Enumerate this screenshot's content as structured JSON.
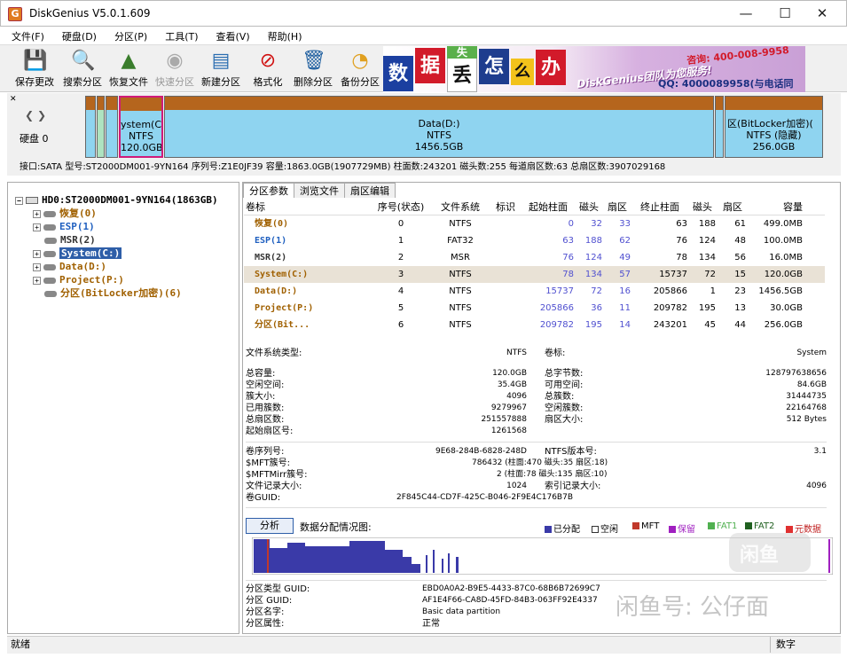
{
  "window": {
    "title": "DiskGenius V5.0.1.609",
    "minimize": "—",
    "maximize": "☐",
    "close": "✕"
  },
  "menu": [
    "文件(F)",
    "硬盘(D)",
    "分区(P)",
    "工具(T)",
    "查看(V)",
    "帮助(H)"
  ],
  "toolbar": [
    {
      "label": "保存更改",
      "icon": "save-icon"
    },
    {
      "label": "搜索分区",
      "icon": "search-icon"
    },
    {
      "label": "恢复文件",
      "icon": "recover-icon"
    },
    {
      "label": "快速分区",
      "icon": "quick-partition-icon"
    },
    {
      "label": "新建分区",
      "icon": "new-partition-icon"
    },
    {
      "label": "格式化",
      "icon": "format-icon"
    },
    {
      "label": "删除分区",
      "icon": "delete-icon"
    },
    {
      "label": "备份分区",
      "icon": "backup-icon"
    }
  ],
  "banner": {
    "tiles": [
      "数",
      "据",
      "丢",
      "失",
      "怎",
      "么",
      "办"
    ],
    "tagline": "DiskGenius团队为您服务!",
    "phone": "咨询: 400-008-9958",
    "qq": "QQ: 4000089958(与电话同号)"
  },
  "disk_label": "硬盘 0",
  "partitions_bar": [
    {
      "line1": "ystem(C",
      "line2": "NTFS",
      "line3": "120.0GB"
    },
    {
      "line1": "Data(D:)",
      "line2": "NTFS",
      "line3": "1456.5GB"
    },
    {
      "line1": "区(BitLocker加密)(",
      "line2": "NTFS (隐藏)",
      "line3": "256.0GB"
    }
  ],
  "disk_info": "接口:SATA  型号:ST2000DM001-9YN164  序列号:Z1E0JF39  容量:1863.0GB(1907729MB)  柱面数:243201  磁头数:255  每道扇区数:63  总扇区数:3907029168",
  "tree": {
    "root": "HD0:ST2000DM001-9YN164(1863GB)",
    "items": [
      "恢复(0)",
      "ESP(1)",
      "MSR(2)",
      "System(C:)",
      "Data(D:)",
      "Project(P:)",
      "分区(BitLocker加密)(6)"
    ]
  },
  "tabs": [
    "分区参数",
    "浏览文件",
    "扇区编辑"
  ],
  "table": {
    "headers": [
      "卷标",
      "序号(状态)",
      "文件系统",
      "标识",
      "起始柱面",
      "磁头",
      "扇区",
      "终止柱面",
      "磁头",
      "扇区",
      "容量"
    ],
    "rows": [
      [
        "恢复(0)",
        "0",
        "NTFS",
        "",
        "0",
        "32",
        "33",
        "63",
        "188",
        "61",
        "499.0MB"
      ],
      [
        "ESP(1)",
        "1",
        "FAT32",
        "",
        "63",
        "188",
        "62",
        "76",
        "124",
        "48",
        "100.0MB"
      ],
      [
        "MSR(2)",
        "2",
        "MSR",
        "",
        "76",
        "124",
        "49",
        "78",
        "134",
        "56",
        "16.0MB"
      ],
      [
        "System(C:)",
        "3",
        "NTFS",
        "",
        "78",
        "134",
        "57",
        "15737",
        "72",
        "15",
        "120.0GB"
      ],
      [
        "Data(D:)",
        "4",
        "NTFS",
        "",
        "15737",
        "72",
        "16",
        "205866",
        "1",
        "23",
        "1456.5GB"
      ],
      [
        "Project(P:)",
        "5",
        "NTFS",
        "",
        "205866",
        "36",
        "11",
        "209782",
        "195",
        "13",
        "30.0GB"
      ],
      [
        "分区(Bit...",
        "6",
        "NTFS",
        "",
        "209782",
        "195",
        "14",
        "243201",
        "45",
        "44",
        "256.0GB"
      ]
    ]
  },
  "fs": {
    "type_label": "文件系统类型:",
    "type_value": "NTFS",
    "vol_label": "卷标:",
    "vol_value": "System",
    "left": [
      [
        "总容量:",
        "120.0GB"
      ],
      [
        "总簇数:",
        "35.4GB"
      ],
      [
        "簇大小:",
        "4096"
      ],
      [
        "已用簇数:",
        "9279967"
      ],
      [
        "总扇区数:",
        "251557888"
      ],
      [
        "起始扇区号:",
        "1261568"
      ]
    ],
    "left_labels_fix": [
      "总容量:",
      "空闲空间:",
      "簇大小:",
      "已用簇数:",
      "总扇区数:",
      "起始扇区号:"
    ],
    "right": [
      [
        "总字节数:",
        "128797638656"
      ],
      [
        "可用空间:",
        "84.6GB"
      ],
      [
        "总簇数:",
        "31444735"
      ],
      [
        "空闲簇数:",
        "22164768"
      ],
      [
        "扇区大小:",
        "512 Bytes"
      ]
    ]
  },
  "ntfs": {
    "serial_label": "卷序列号:",
    "serial_value": "9E68-284B-6828-248D",
    "ver_label": "NTFS版本号:",
    "ver_value": "3.1",
    "mft_label": "$MFT簇号:",
    "mft_value": "786432 (柱面:470 磁头:35 扇区:18)",
    "mftm_label": "$MFTMirr簇号:",
    "mftm_value": "2 (柱面:78 磁头:135 扇区:10)",
    "rec_label": "文件记录大小:",
    "rec_value": "1024",
    "idx_label": "索引记录大小:",
    "idx_value": "4096",
    "guid_label": "卷GUID:",
    "guid_value": "2F845C44-CD7F-425C-B046-2F9E4C176B7B"
  },
  "analysis": {
    "button": "分析",
    "title": "数据分配情况图:",
    "legend": [
      {
        "label": "已分配",
        "color": "#3a3aa8"
      },
      {
        "label": "空闲",
        "color": "#ffffff"
      },
      {
        "label": "MFT",
        "color": "#c0392b"
      },
      {
        "label": "保留",
        "color": "#a020c0"
      },
      {
        "label": "FAT1",
        "color": "#50b050"
      },
      {
        "label": "FAT2",
        "color": "#206020"
      },
      {
        "label": "元数据",
        "color": "#e03030"
      }
    ]
  },
  "guid": {
    "type_label": "分区类型 GUID:",
    "type_value": "EBD0A0A2-B9E5-4433-87C0-68B6B72699C7",
    "part_label": "分区 GUID:",
    "part_value": "AF1E4F66-CA8D-45FD-84B3-063FF92E4337",
    "name_label": "分区名字:",
    "name_value": "Basic data partition",
    "attr_label": "分区属性:",
    "attr_value": "正常"
  },
  "watermark": {
    "logo": "闲鱼",
    "text": "闲鱼号: 公仔面"
  },
  "status": {
    "left": "就绪",
    "right": "数字"
  }
}
